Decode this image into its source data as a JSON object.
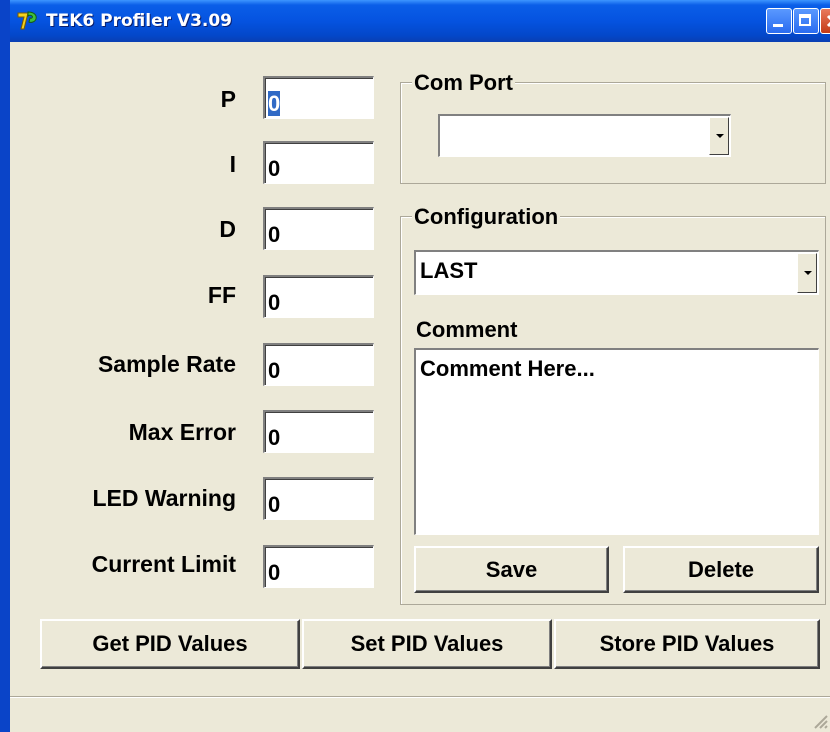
{
  "window": {
    "title": "TEK6 Profiler V3.09",
    "icon": "app-icon",
    "titlebar_color": "#0a5ee8"
  },
  "fields": [
    {
      "label": "P",
      "value": "0"
    },
    {
      "label": "I",
      "value": "0"
    },
    {
      "label": "D",
      "value": "0"
    },
    {
      "label": "FF",
      "value": "0"
    },
    {
      "label": "Sample Rate",
      "value": "0"
    },
    {
      "label": "Max Error",
      "value": "0"
    },
    {
      "label": "LED Warning",
      "value": "0"
    },
    {
      "label": "Current Limit",
      "value": "0"
    }
  ],
  "com_port": {
    "title": "Com Port",
    "selected": ""
  },
  "configuration": {
    "title": "Configuration",
    "selected": "LAST",
    "comment_label": "Comment",
    "comment_text": "Comment Here...",
    "save_label": "Save",
    "delete_label": "Delete"
  },
  "actions": {
    "get_label": "Get PID Values",
    "set_label": "Set PID Values",
    "store_label": "Store PID Values"
  }
}
